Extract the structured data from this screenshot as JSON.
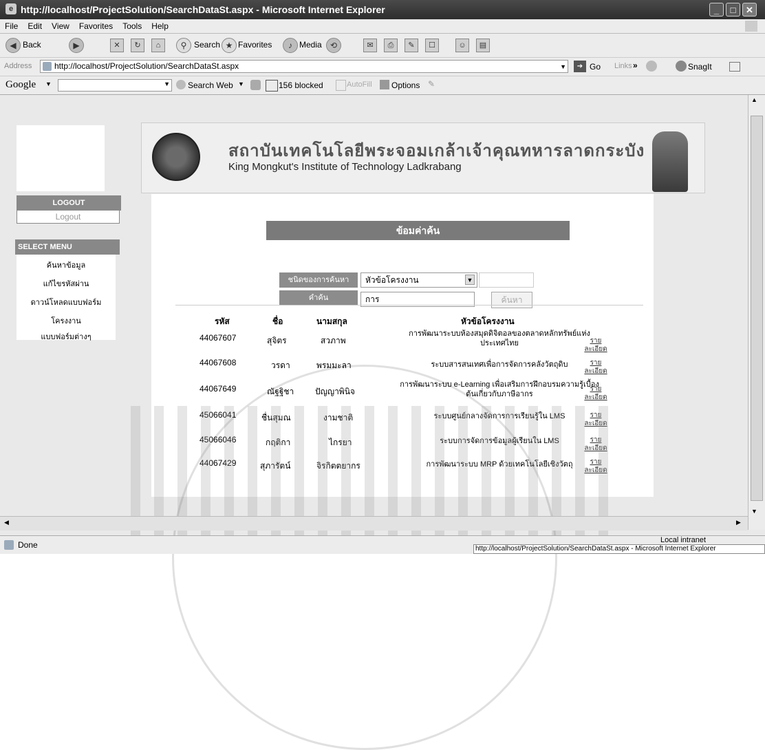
{
  "window": {
    "title": "http://localhost/ProjectSolution/SearchDataSt.aspx - Microsoft Internet Explorer"
  },
  "menu": [
    "File",
    "Edit",
    "View",
    "Favorites",
    "Tools",
    "Help"
  ],
  "toolbar": {
    "back": "Back",
    "search": "Search",
    "favorites": "Favorites",
    "media": "Media"
  },
  "address": {
    "label": "Address",
    "url": "http://localhost/ProjectSolution/SearchDataSt.aspx",
    "go": "Go",
    "links": "Links",
    "snagit": "SnagIt"
  },
  "google": {
    "logo": "Google",
    "search_web": "Search Web",
    "blocked": "156 blocked",
    "autofill": "AutoFill",
    "options": "Options"
  },
  "banner": {
    "thai_title": "สถาบันเทคโนโลยีพระจอมเกล้าเจ้าคุณทหารลาดกระบัง",
    "english_title": "King Mongkut's Institute of Technology Ladkrabang"
  },
  "sidebar": {
    "logout_header": "LOGOUT",
    "logout_input": "Logout",
    "select_header": "SELECT MENU",
    "items": [
      "ค้นหาข้อมูล",
      "แก้ไขรหัสผ่าน",
      "ดาวน์โหลดแบบฟอร์ม",
      "โครงงาน",
      "แบบฟอร์มต่างๆ"
    ]
  },
  "search": {
    "title": "ข้อมค่าค้น",
    "type_label": "ชนิดของการค้นหา",
    "type_value": "หัวข้อโครงงาน",
    "keyword_label": "คำค้น",
    "keyword_value": "การ",
    "button": "ค้นหา"
  },
  "table": {
    "headers": [
      "รหัส",
      "ชื่อ",
      "นามสกุล",
      "หัวข้อโครงงาน"
    ],
    "detail_link": "รายละเอียด",
    "rows": [
      {
        "id": "44067607",
        "name": "สุจิตร",
        "surname": "สวภาพ",
        "topic": "การพัฒนาระบบห้องสมุดดิจิตอลของตลาดหลักทรัพย์แห่งประเทศไทย"
      },
      {
        "id": "44067608",
        "name": "วรดา",
        "surname": "พรมมะลา",
        "topic": "ระบบสารสนเทศเพื่อการจัดการคลังวัตถุดิบ"
      },
      {
        "id": "44067649",
        "name": "ณัฐฐิชา",
        "surname": "ปัญญาพินิจ",
        "topic": "การพัฒนาระบบ e-Learning เพื่อเสริมการฝึกอบรมความรู้เบื้องต้นเกี่ยวกับภาษีอากร"
      },
      {
        "id": "45066041",
        "name": "ชื่นสุมณ",
        "surname": "งามชาติ",
        "topic": "ระบบศูนย์กลางจัดการการเรียนรู้ใน LMS"
      },
      {
        "id": "45066046",
        "name": "กฤติกา",
        "surname": "ไกรยา",
        "topic": "ระบบการจัดการข้อมูลผู้เรียนใน LMS"
      },
      {
        "id": "44067429",
        "name": "สุภารัตน์",
        "surname": "จิรกิตตยากร",
        "topic": "การพัฒนาระบบ MRP ด้วยเทคโนโลยีเชิงวัตถุ"
      }
    ]
  },
  "status": {
    "left": "Done",
    "zone": "Local intranet",
    "taskbar": "http://localhost/ProjectSolution/SearchDataSt.aspx - Microsoft Internet Explorer"
  }
}
